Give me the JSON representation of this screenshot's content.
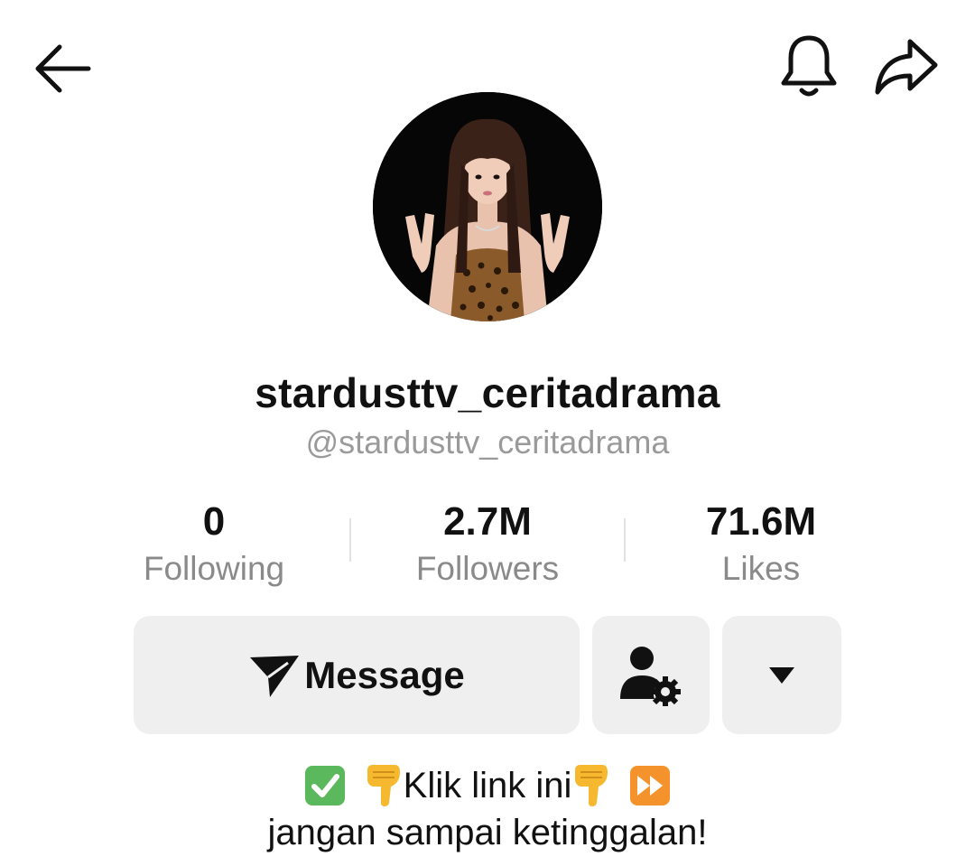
{
  "header": {
    "back_icon": "arrow-left-icon",
    "notification_icon": "bell-icon",
    "share_icon": "share-arrow-icon"
  },
  "profile": {
    "display_name": "stardusttv_ceritadrama",
    "handle": "@stardusttv_ceritadrama"
  },
  "stats": [
    {
      "value": "0",
      "label": "Following"
    },
    {
      "value": "2.7M",
      "label": "Followers"
    },
    {
      "value": "71.6M",
      "label": "Likes"
    }
  ],
  "actions": {
    "message_label": "Message",
    "message_icon": "send-icon",
    "friend_icon": "user-settings-icon",
    "more_icon": "triangle-down-icon"
  },
  "bio": {
    "line1_text": "Klik link ini",
    "line2": "jangan sampai ketinggalan!",
    "line1_emojis": [
      "check-mark-emoji",
      "pointing-down-emoji",
      "pointing-down-emoji",
      "fast-forward-emoji"
    ]
  },
  "colors": {
    "button_bg": "#efefef",
    "handle_text": "#9a9a9a",
    "label_text": "#8a8a8a",
    "check_green": "#5cb85c",
    "fast_forward_orange": "#f4922c",
    "hand_yellow": "#f5b82e"
  }
}
